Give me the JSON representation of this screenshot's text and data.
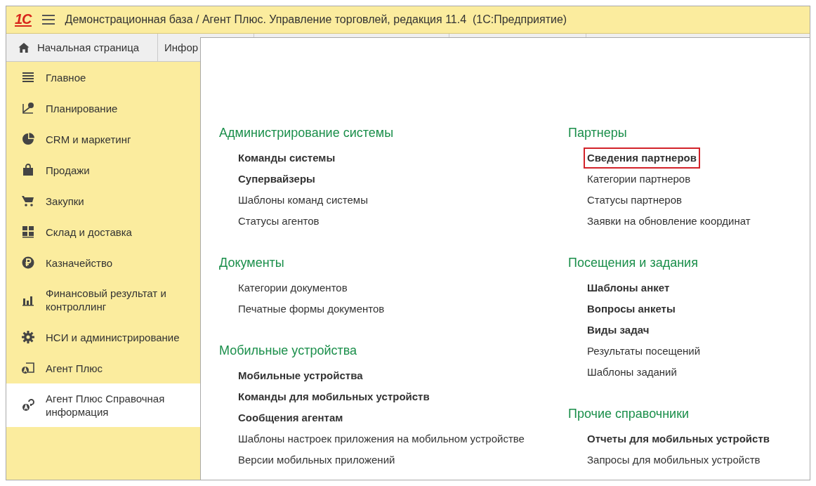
{
  "window": {
    "logo": "1С",
    "title": "Демонстрационная база / Агент Плюс. Управление торговлей, редакция 11.4  (1С:Предприятие)"
  },
  "tabs": [
    {
      "label": "Начальная страница",
      "kind": "home"
    },
    {
      "label": "Инфор",
      "kind": "plain"
    }
  ],
  "sidebar": {
    "items": [
      {
        "label": "Главное",
        "kind": "list",
        "selected": false
      },
      {
        "label": "Планирование",
        "kind": "axes",
        "selected": false
      },
      {
        "label": "CRM и маркетинг",
        "kind": "pie",
        "selected": false
      },
      {
        "label": "Продажи",
        "kind": "bag",
        "selected": false
      },
      {
        "label": "Закупки",
        "kind": "cart",
        "selected": false
      },
      {
        "label": "Склад и доставка",
        "kind": "grid",
        "selected": false
      },
      {
        "label": "Казначейство",
        "kind": "coin",
        "selected": false
      },
      {
        "label": "Финансовый результат и контроллинг",
        "kind": "bars",
        "selected": false
      },
      {
        "label": "НСИ и администрирование",
        "kind": "gear",
        "selected": false
      },
      {
        "label": "Агент Плюс",
        "kind": "agent",
        "selected": false
      },
      {
        "label": "Агент Плюс Справочная информация",
        "kind": "agentq",
        "selected": true
      }
    ]
  },
  "panel": {
    "columns": [
      [
        {
          "heading": "Администрирование системы",
          "items": [
            {
              "label": "Команды системы",
              "bold": true,
              "highlighted": false
            },
            {
              "label": "Супервайзеры",
              "bold": true,
              "highlighted": false
            },
            {
              "label": "Шаблоны команд системы",
              "bold": false,
              "highlighted": false
            },
            {
              "label": "Статусы агентов",
              "bold": false,
              "highlighted": false
            }
          ]
        },
        {
          "heading": "Документы",
          "items": [
            {
              "label": "Категории документов",
              "bold": false,
              "highlighted": false
            },
            {
              "label": "Печатные формы документов",
              "bold": false,
              "highlighted": false
            }
          ]
        },
        {
          "heading": "Мобильные устройства",
          "items": [
            {
              "label": "Мобильные устройства",
              "bold": true,
              "highlighted": false
            },
            {
              "label": "Команды для мобильных устройств",
              "bold": true,
              "highlighted": false
            },
            {
              "label": "Сообщения агентам",
              "bold": true,
              "highlighted": false
            },
            {
              "label": "Шаблоны настроек приложения на мобильном устройстве",
              "bold": false,
              "highlighted": false
            },
            {
              "label": "Версии мобильных приложений",
              "bold": false,
              "highlighted": false
            }
          ]
        }
      ],
      [
        {
          "heading": "Партнеры",
          "items": [
            {
              "label": "Сведения партнеров",
              "bold": true,
              "highlighted": true
            },
            {
              "label": "Категории партнеров",
              "bold": false,
              "highlighted": false
            },
            {
              "label": "Статусы партнеров",
              "bold": false,
              "highlighted": false
            },
            {
              "label": "Заявки на обновление координат",
              "bold": false,
              "highlighted": false
            }
          ]
        },
        {
          "heading": "Посещения и задания",
          "items": [
            {
              "label": "Шаблоны анкет",
              "bold": true,
              "highlighted": false
            },
            {
              "label": "Вопросы анкеты",
              "bold": true,
              "highlighted": false
            },
            {
              "label": "Виды задач",
              "bold": true,
              "highlighted": false
            },
            {
              "label": "Результаты посещений",
              "bold": false,
              "highlighted": false
            },
            {
              "label": "Шаблоны заданий",
              "bold": false,
              "highlighted": false
            }
          ]
        },
        {
          "heading": "Прочие справочники",
          "items": [
            {
              "label": "Отчеты для мобильных устройств",
              "bold": true,
              "highlighted": false
            },
            {
              "label": "Запросы для мобильных устройств",
              "bold": false,
              "highlighted": false
            }
          ]
        }
      ]
    ]
  }
}
